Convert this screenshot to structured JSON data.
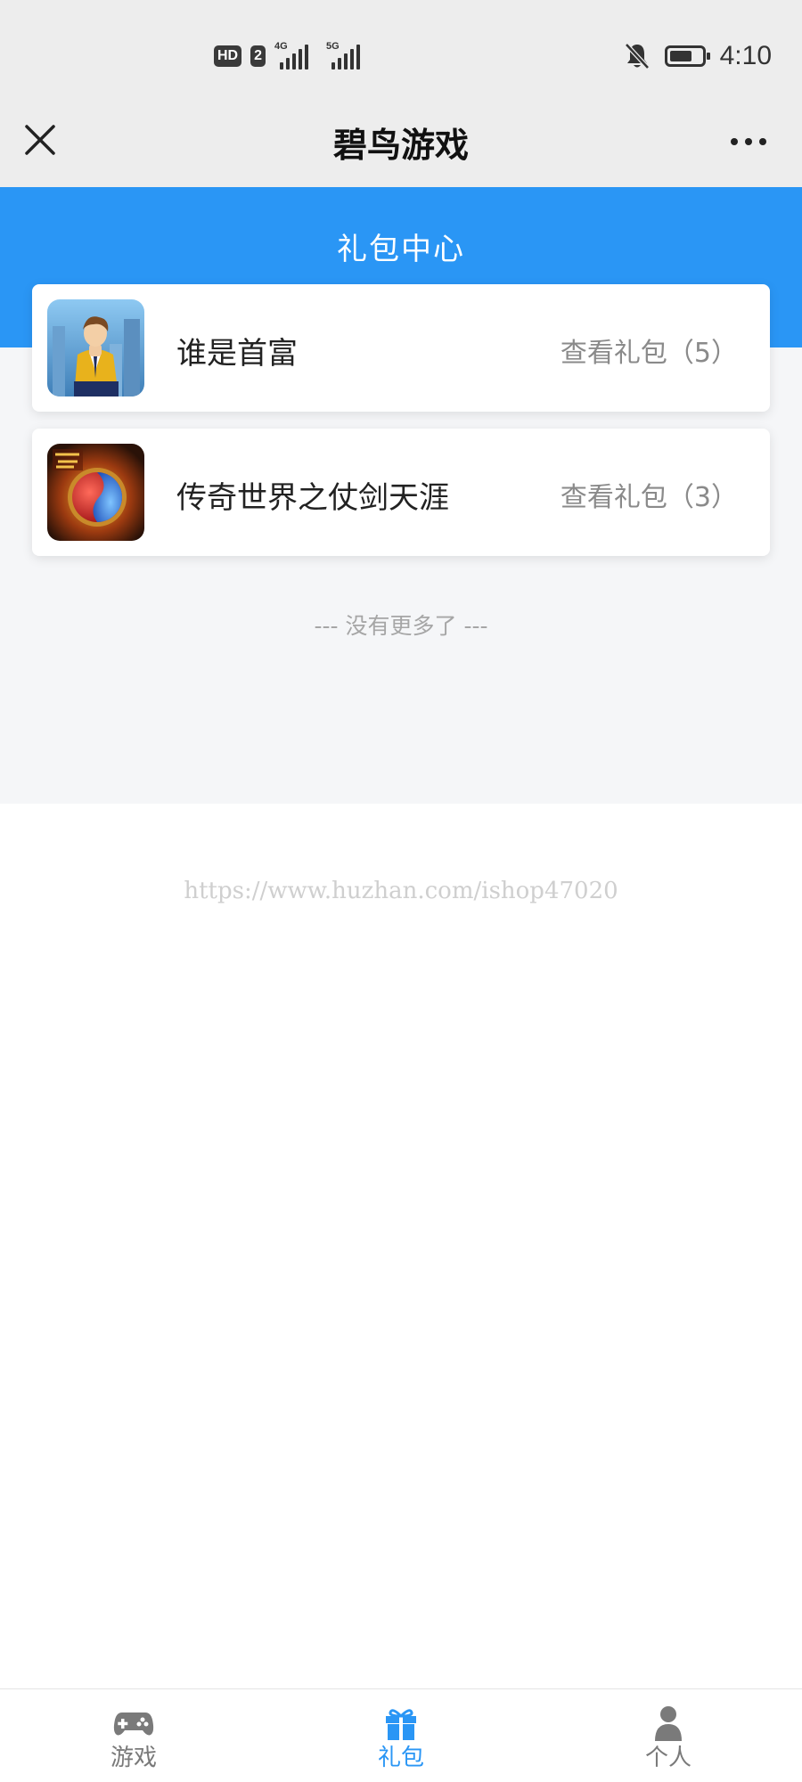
{
  "status_bar": {
    "hd_label": "HD",
    "sim_label": "2",
    "network_1": "4G",
    "network_2": "5G",
    "time": "4:10",
    "battery_level": 0.72
  },
  "title_bar": {
    "title": "碧鸟游戏",
    "close_icon": "close-icon",
    "more_icon": "more-icon"
  },
  "header": {
    "title": "礼包中心"
  },
  "games": [
    {
      "name": "谁是首富",
      "gift_link": "查看礼包（5）",
      "icon": "businessman-game-icon"
    },
    {
      "name": "传奇世界之仗剑天涯",
      "gift_link": "查看礼包（3）",
      "icon": "legend-orb-game-icon"
    }
  ],
  "end_text": "--- 没有更多了 ---",
  "watermark": "https://www.huzhan.com/ishop47020",
  "bottom_nav": {
    "items": [
      {
        "label": "游戏",
        "icon": "gamepad-icon",
        "active": false
      },
      {
        "label": "礼包",
        "icon": "gift-icon",
        "active": true
      },
      {
        "label": "个人",
        "icon": "person-icon",
        "active": false
      }
    ]
  },
  "colors": {
    "accent": "#2a96f5",
    "title_bar_bg": "#ededed",
    "content_bg": "#f5f6f8",
    "muted_text": "#8a8a8a"
  }
}
